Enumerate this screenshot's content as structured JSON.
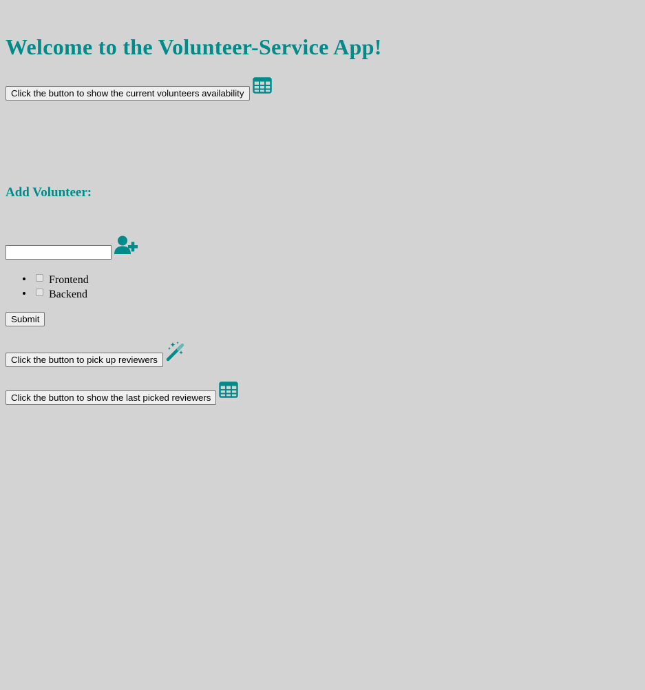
{
  "title": "Welcome to the Volunteer-Service App!",
  "show_availability": {
    "button_label": "Click the button to show the current volunteers availability",
    "icon": "table-icon"
  },
  "add_volunteer": {
    "heading": "Add Volunteer:",
    "name_input_value": "",
    "name_input_placeholder": "",
    "icon": "user-plus-icon",
    "roles": [
      {
        "label": "Frontend",
        "checked": false
      },
      {
        "label": "Backend",
        "checked": false
      }
    ],
    "submit_label": "Submit"
  },
  "pick_reviewers": {
    "button_label": "Click the button to pick up reviewers",
    "icon": "magic-wand-icon"
  },
  "last_reviewers": {
    "button_label": "Click the button to show the last picked reviewers",
    "icon": "table-icon"
  },
  "colors": {
    "background": "#d3d3d3",
    "accent": "#008b8b"
  }
}
